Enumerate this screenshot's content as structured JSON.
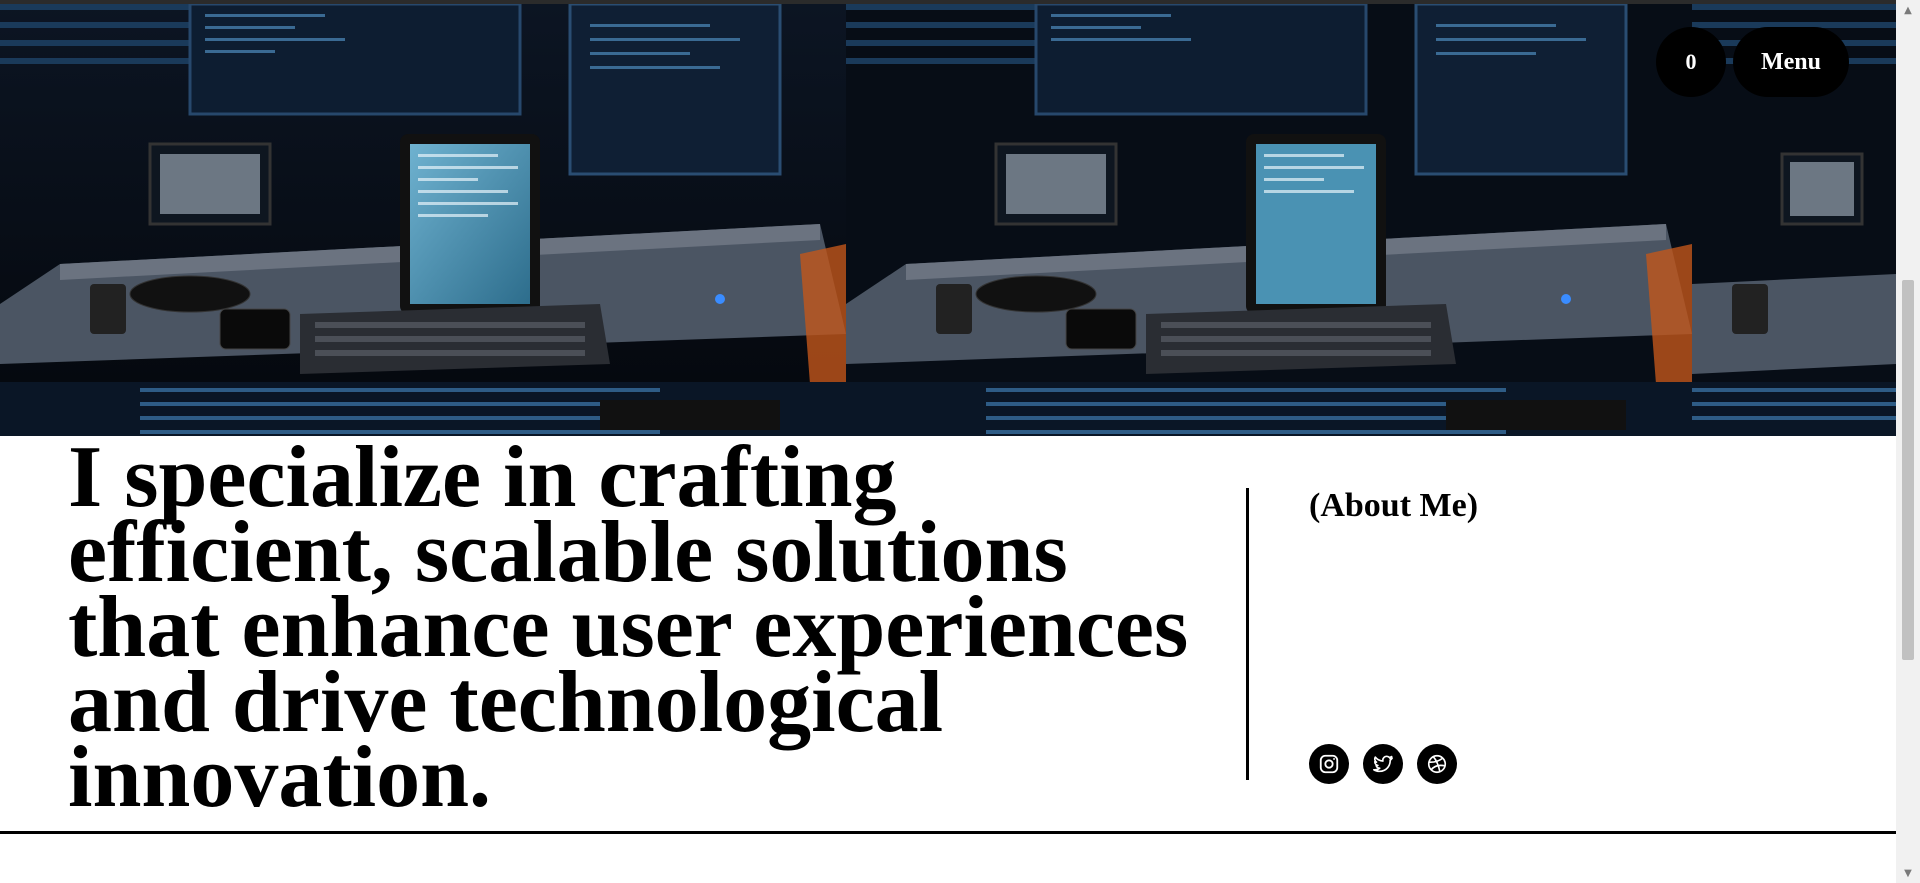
{
  "header": {
    "cart_count": "0",
    "menu_label": "Menu"
  },
  "hero": {
    "image_icon": "desk-setup-photo"
  },
  "intro": {
    "headline": "I specialize in crafting efficient, scalable solutions that enhance user experiences and drive technological innovation.",
    "section_label": "(About Me)"
  },
  "socials": [
    {
      "name": "instagram-icon"
    },
    {
      "name": "twitter-icon"
    },
    {
      "name": "dribbble-icon"
    }
  ],
  "colors": {
    "background": "#ffffff",
    "text": "#000000",
    "button_bg": "#000000",
    "button_text": "#ffffff"
  }
}
